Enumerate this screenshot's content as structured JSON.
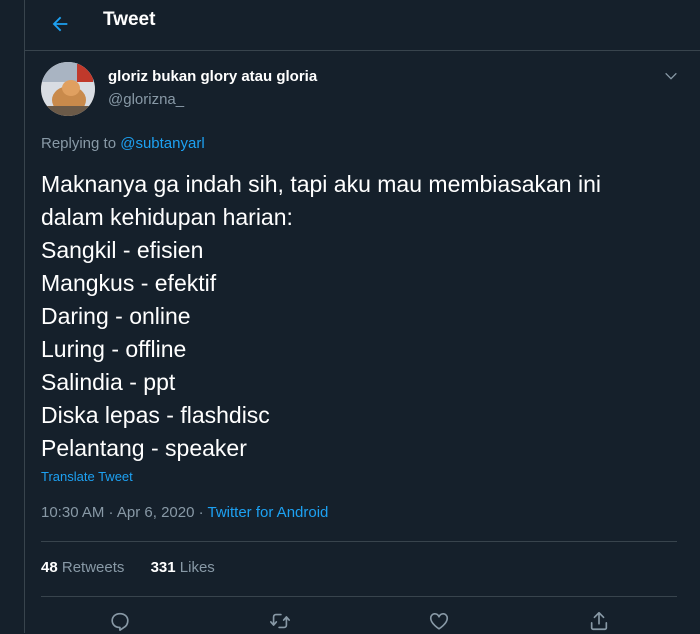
{
  "header": {
    "title": "Tweet"
  },
  "tweet": {
    "author_name": "gloriz bukan glory atau gloria",
    "author_handle": "@glorizna_",
    "replying_prefix": "Replying to",
    "replying_to": "@subtanyarl",
    "text_lines": [
      "Maknanya ga indah sih, tapi aku mau membiasakan ini",
      "dalam kehidupan harian:",
      "Sangkil - efisien",
      "Mangkus - efektif",
      "Daring - online",
      "Luring - offline",
      "Salindia - ppt",
      "Diska lepas - flashdisc",
      "Pelantang - speaker"
    ],
    "translate_label": "Translate Tweet",
    "timestamp": "10:30 AM · Apr 6, 2020",
    "separator": " · ",
    "source": "Twitter for Android",
    "retweets_count": "48",
    "retweets_label": "Retweets",
    "likes_count": "331",
    "likes_label": "Likes"
  },
  "icons": {
    "back": "arrow-left-icon",
    "more": "chevron-down-icon",
    "reply": "reply-icon",
    "retweet": "retweet-icon",
    "like": "heart-icon",
    "share": "share-icon"
  },
  "colors": {
    "background": "#15202b",
    "accent": "#1da1f2",
    "secondary_text": "#8899a6",
    "border": "#38444d"
  }
}
